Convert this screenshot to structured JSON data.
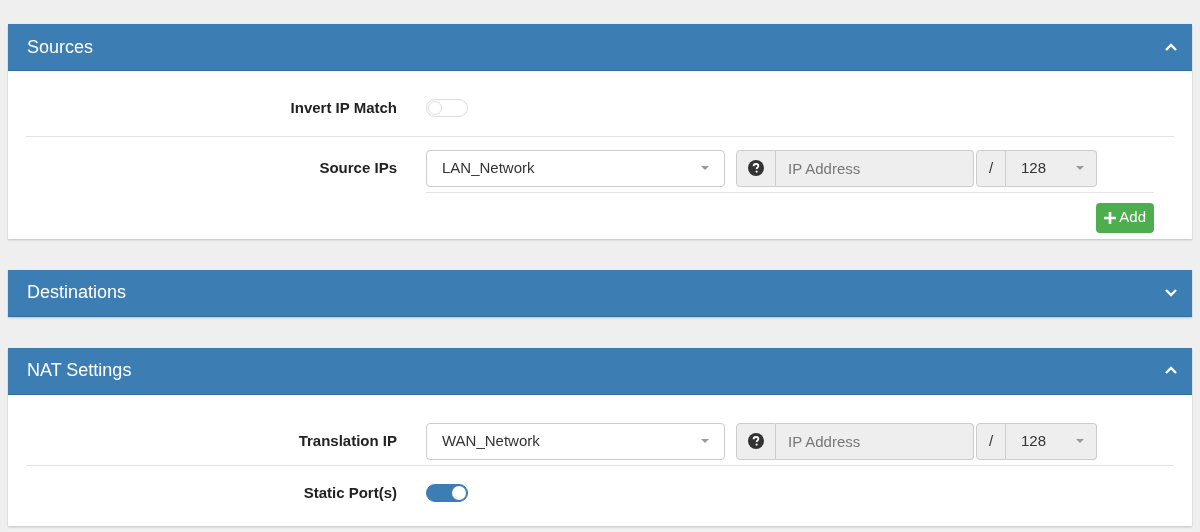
{
  "sections": [
    {
      "title": "Sources",
      "expanded": true,
      "rows": [
        {
          "kind": "toggle",
          "label": "Invert IP Match",
          "on": false
        },
        {
          "kind": "ip",
          "label": "Source IPs",
          "network": "LAN_Network",
          "address_placeholder": "IP Address",
          "address_disabled": true,
          "slash": "/",
          "mask": "128",
          "add_label": "Add"
        }
      ]
    },
    {
      "title": "Destinations",
      "expanded": false
    },
    {
      "title": "NAT Settings",
      "expanded": true,
      "rows": [
        {
          "kind": "ip",
          "label": "Translation IP",
          "network": "WAN_Network",
          "address_placeholder": "IP Address",
          "address_disabled": true,
          "slash": "/",
          "mask": "128"
        },
        {
          "kind": "toggle",
          "label": "Static Port(s)",
          "on": true
        }
      ]
    }
  ]
}
